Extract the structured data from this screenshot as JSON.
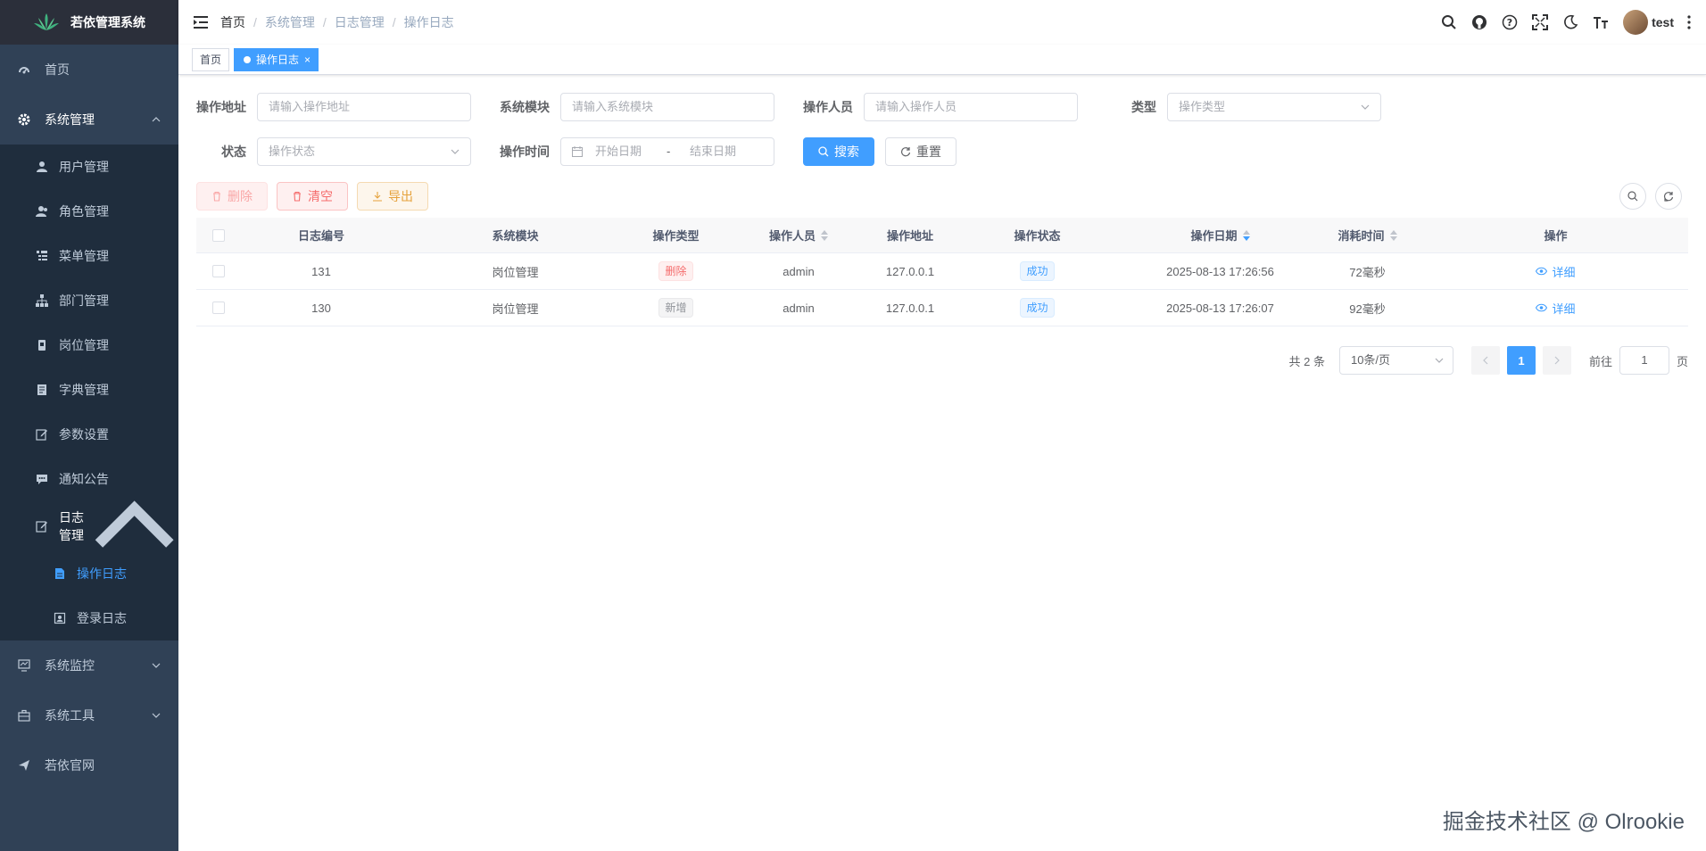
{
  "app": {
    "title": "若依管理系统"
  },
  "sidebar": {
    "home": "首页",
    "system": "系统管理",
    "system_items": [
      {
        "label": "用户管理",
        "icon": "user-icon"
      },
      {
        "label": "角色管理",
        "icon": "peoples-icon"
      },
      {
        "label": "菜单管理",
        "icon": "tree-table-icon"
      },
      {
        "label": "部门管理",
        "icon": "tree-icon"
      },
      {
        "label": "岗位管理",
        "icon": "post-icon"
      },
      {
        "label": "字典管理",
        "icon": "dict-icon"
      },
      {
        "label": "参数设置",
        "icon": "edit-icon"
      },
      {
        "label": "通知公告",
        "icon": "message-icon"
      }
    ],
    "log": "日志管理",
    "log_items": [
      {
        "label": "操作日志",
        "icon": "form-icon",
        "active": true
      },
      {
        "label": "登录日志",
        "icon": "logininfor-icon"
      }
    ],
    "monitor": "系统监控",
    "tool": "系统工具",
    "website": "若依官网"
  },
  "navbar": {
    "breadcrumb": [
      "首页",
      "系统管理",
      "日志管理",
      "操作日志"
    ],
    "username": "test"
  },
  "tags": {
    "home": "首页",
    "active": "操作日志",
    "close": "×"
  },
  "search": {
    "oper_ip_label": "操作地址",
    "oper_ip_placeholder": "请输入操作地址",
    "module_label": "系统模块",
    "module_placeholder": "请输入系统模块",
    "oper_name_label": "操作人员",
    "oper_name_placeholder": "请输入操作人员",
    "type_label": "类型",
    "type_placeholder": "操作类型",
    "status_label": "状态",
    "status_placeholder": "操作状态",
    "time_label": "操作时间",
    "start_placeholder": "开始日期",
    "range_sep": "-",
    "end_placeholder": "结束日期",
    "search_btn": "搜索",
    "reset_btn": "重置"
  },
  "toolbar": {
    "delete": "删除",
    "clean": "清空",
    "export": "导出"
  },
  "table": {
    "headers": [
      "日志编号",
      "系统模块",
      "操作类型",
      "操作人员",
      "操作地址",
      "操作状态",
      "操作日期",
      "消耗时间",
      "操作"
    ],
    "rows": [
      {
        "id": "131",
        "module": "岗位管理",
        "type": "删除",
        "type_style": "danger",
        "user": "admin",
        "ip": "127.0.0.1",
        "status": "成功",
        "date": "2025-08-13 17:26:56",
        "cost": "72毫秒",
        "action": "详细"
      },
      {
        "id": "130",
        "module": "岗位管理",
        "type": "新增",
        "type_style": "info",
        "user": "admin",
        "ip": "127.0.0.1",
        "status": "成功",
        "date": "2025-08-13 17:26:07",
        "cost": "92毫秒",
        "action": "详细"
      }
    ]
  },
  "pagination": {
    "total": "共 2 条",
    "page_size": "10条/页",
    "current": "1",
    "goto_prefix": "前往",
    "goto_value": "1",
    "goto_suffix": "页"
  },
  "watermark": "掘金技术社区 @ Olrookie",
  "colors": {
    "primary": "#409eff",
    "sidebar_bg": "#304156",
    "submenu_bg": "#1f2d3d",
    "danger": "#f56c6c",
    "warning": "#e6a23c"
  }
}
